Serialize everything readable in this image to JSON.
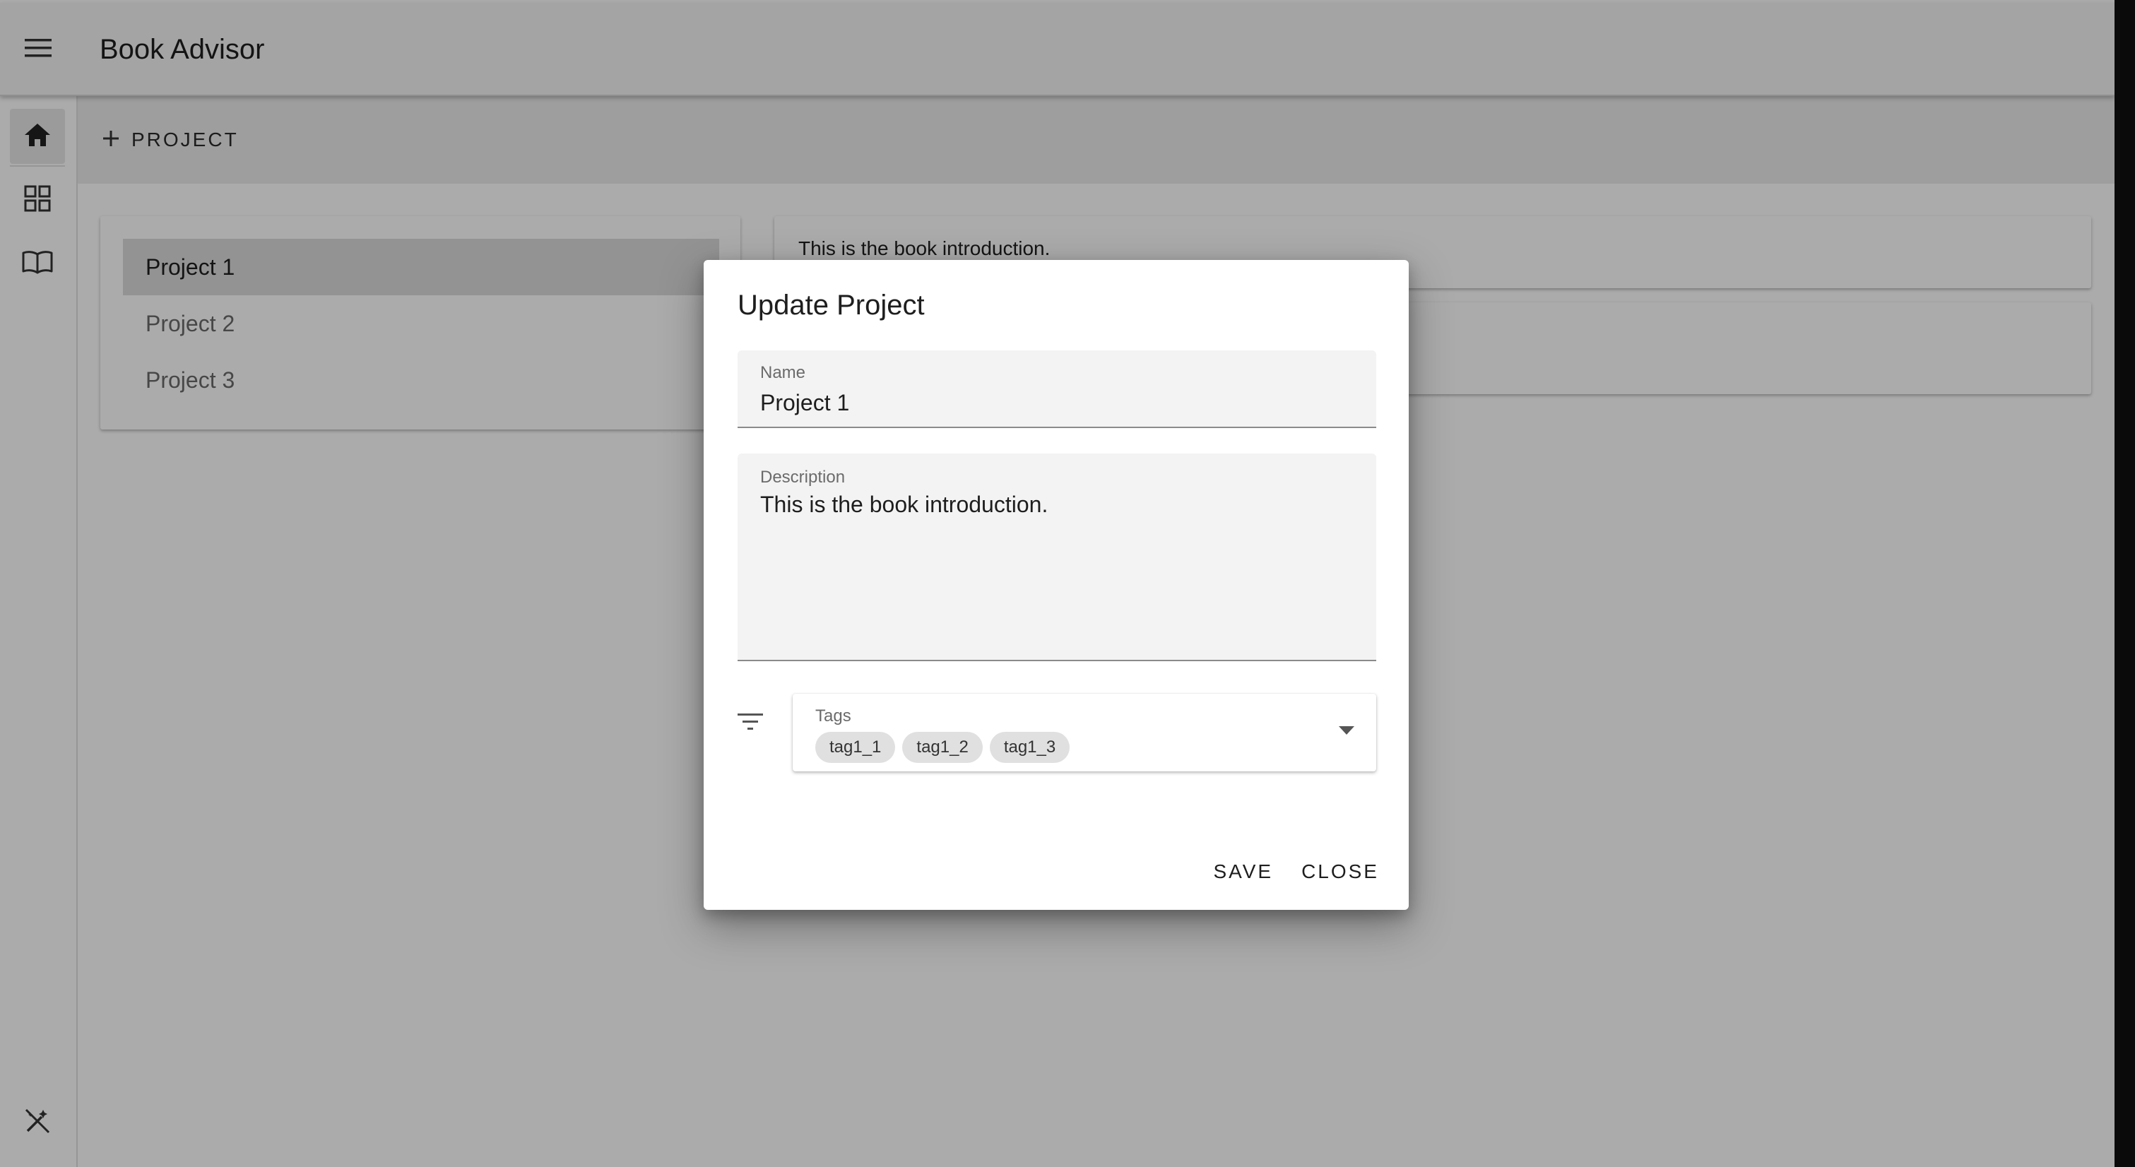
{
  "app": {
    "title": "Book Advisor",
    "menu_icon": "hamburger-menu-icon"
  },
  "rail": {
    "items": [
      {
        "name": "home",
        "icon": "home-icon",
        "active": true
      },
      {
        "name": "dashboard",
        "icon": "grid-view-icon",
        "active": false
      },
      {
        "name": "books",
        "icon": "open-book-icon",
        "active": false
      }
    ],
    "footer_icon": "auto-fix-off-icon"
  },
  "toolbar": {
    "add_project_label": "PROJECT",
    "add_icon": "plus-icon"
  },
  "projects": {
    "items": [
      {
        "label": "Project 1",
        "selected": true
      },
      {
        "label": "Project 2",
        "selected": false
      },
      {
        "label": "Project 3",
        "selected": false
      }
    ]
  },
  "detail": {
    "intro_text": "This is the book introduction."
  },
  "dialog": {
    "title": "Update Project",
    "name_label": "Name",
    "name_value": "Project 1",
    "description_label": "Description",
    "description_value": "This is the book introduction.",
    "filter_icon": "filter-list-icon",
    "tags_label": "Tags",
    "tags": [
      "tag1_1",
      "tag1_2",
      "tag1_3"
    ],
    "dropdown_icon": "arrow-drop-down-icon",
    "save_label": "SAVE",
    "close_label": "CLOSE"
  },
  "colors": {
    "appbar": "#f5f5f5",
    "scrim": "rgba(0,0,0,0.33)",
    "selected_item": "#dcdcdc",
    "chip": "#e0e0e0"
  }
}
